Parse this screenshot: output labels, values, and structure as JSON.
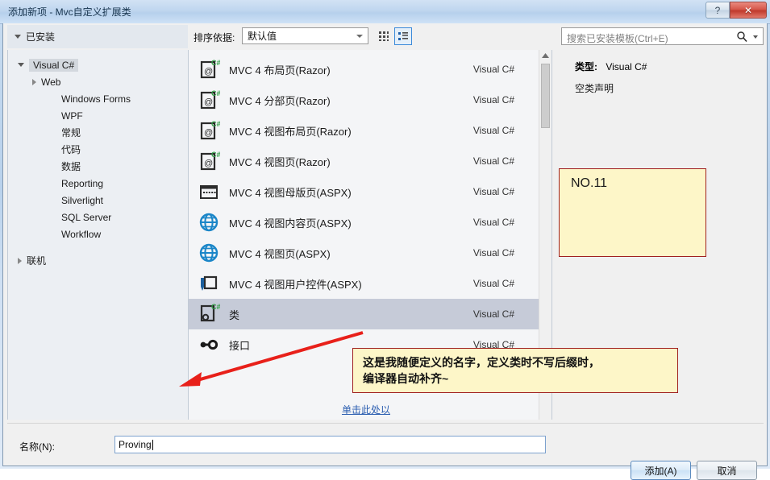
{
  "window": {
    "title": "添加新项 - Mvc自定义扩展类",
    "help_button": "?",
    "close_button": "✕"
  },
  "toolbar": {
    "installed_label": "已安装",
    "sort_label": "排序依据:",
    "sort_value": "默认值",
    "grid_view_icon": "grid-view-icon",
    "list_view_icon": "list-view-icon",
    "search_placeholder": "搜索已安装模板(Ctrl+E)",
    "search_icon": "search-icon"
  },
  "sidebar": {
    "items": [
      {
        "label": "Visual C#",
        "level": 0,
        "expander": "down",
        "selected": true
      },
      {
        "label": "Web",
        "level": 1,
        "expander": "right",
        "selected": false
      },
      {
        "label": "Windows Forms",
        "level": 2,
        "expander": "none",
        "selected": false
      },
      {
        "label": "WPF",
        "level": 2,
        "expander": "none",
        "selected": false
      },
      {
        "label": "常规",
        "level": 2,
        "expander": "none",
        "selected": false
      },
      {
        "label": "代码",
        "level": 2,
        "expander": "none",
        "selected": false
      },
      {
        "label": "数据",
        "level": 2,
        "expander": "none",
        "selected": false
      },
      {
        "label": "Reporting",
        "level": 2,
        "expander": "none",
        "selected": false
      },
      {
        "label": "Silverlight",
        "level": 2,
        "expander": "none",
        "selected": false
      },
      {
        "label": "SQL Server",
        "level": 2,
        "expander": "none",
        "selected": false
      },
      {
        "label": "Workflow",
        "level": 2,
        "expander": "none",
        "selected": false
      },
      {
        "label": "联机",
        "level": 0,
        "expander": "right",
        "selected": false
      }
    ]
  },
  "templates": {
    "items": [
      {
        "name": "MVC 4 布局页(Razor)",
        "lang": "Visual C#",
        "icon": "razor-page-icon",
        "selected": false
      },
      {
        "name": "MVC 4 分部页(Razor)",
        "lang": "Visual C#",
        "icon": "razor-page-icon",
        "selected": false
      },
      {
        "name": "MVC 4 视图布局页(Razor)",
        "lang": "Visual C#",
        "icon": "razor-page-icon",
        "selected": false
      },
      {
        "name": "MVC 4 视图页(Razor)",
        "lang": "Visual C#",
        "icon": "razor-page-icon",
        "selected": false
      },
      {
        "name": "MVC 4 视图母版页(ASPX)",
        "lang": "Visual C#",
        "icon": "master-page-icon",
        "selected": false
      },
      {
        "name": "MVC 4 视图内容页(ASPX)",
        "lang": "Visual C#",
        "icon": "globe-icon",
        "selected": false
      },
      {
        "name": "MVC 4 视图页(ASPX)",
        "lang": "Visual C#",
        "icon": "globe-icon",
        "selected": false
      },
      {
        "name": "MVC 4 视图用户控件(ASPX)",
        "lang": "Visual C#",
        "icon": "user-control-icon",
        "selected": false
      },
      {
        "name": "类",
        "lang": "Visual C#",
        "icon": "class-icon",
        "selected": true
      },
      {
        "name": "接口",
        "lang": "Visual C#",
        "icon": "interface-icon",
        "selected": false
      }
    ],
    "online_link": "单击此处以"
  },
  "details": {
    "type_label": "类型:",
    "type_value": "Visual C#",
    "description": "空类声明"
  },
  "footer": {
    "name_label": "名称(N):",
    "name_value": "Proving",
    "add_button": "添加(A)",
    "cancel_button": "取消"
  },
  "annotations": {
    "badge": "NO.11",
    "note_line1": "这是我随便定义的名字，定义类时不写后缀时，",
    "note_line2": "编译器自动补齐~",
    "arrow_color": "#e8201a",
    "callout_border": "#a02020",
    "callout_fill": "#fdf6c8"
  }
}
